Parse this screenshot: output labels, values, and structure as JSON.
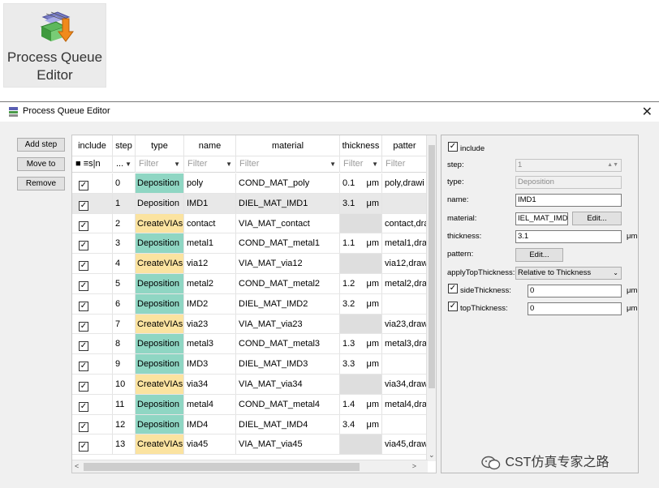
{
  "ribbon": {
    "label": "Process Queue\nEditor",
    "icon": "process-queue-icon"
  },
  "dialog": {
    "title": "Process Queue Editor",
    "close": "✕"
  },
  "left_buttons": [
    "Add step",
    "Move to",
    "Remove"
  ],
  "table": {
    "columns": [
      "include",
      "step",
      "type",
      "name",
      "material",
      "thickness",
      "patter"
    ],
    "filter_row": {
      "include": "■  ≡s|n",
      "step": "...",
      "type": "Filter",
      "name": "Filter",
      "material": "Filter",
      "thickness": "Filter",
      "pattern": "Filter"
    },
    "rows": [
      {
        "step": "0",
        "type": "Deposition",
        "name": "poly",
        "material": "COND_MAT_poly",
        "thickness": "0.1",
        "unit": "μm",
        "pattern": "poly,drawi"
      },
      {
        "step": "1",
        "type": "Deposition",
        "name": "IMD1",
        "material": "DIEL_MAT_IMD1",
        "thickness": "3.1",
        "unit": "μm",
        "pattern": ""
      },
      {
        "step": "2",
        "type": "CreateVIAs",
        "name": "contact",
        "material": "VIA_MAT_contact",
        "thickness": "",
        "unit": "",
        "pattern": "contact,dra"
      },
      {
        "step": "3",
        "type": "Deposition",
        "name": "metal1",
        "material": "COND_MAT_metal1",
        "thickness": "1.1",
        "unit": "μm",
        "pattern": "metal1,dra"
      },
      {
        "step": "4",
        "type": "CreateVIAs",
        "name": "via12",
        "material": "VIA_MAT_via12",
        "thickness": "",
        "unit": "",
        "pattern": "via12,draw"
      },
      {
        "step": "5",
        "type": "Deposition",
        "name": "metal2",
        "material": "COND_MAT_metal2",
        "thickness": "1.2",
        "unit": "μm",
        "pattern": "metal2,dra"
      },
      {
        "step": "6",
        "type": "Deposition",
        "name": "IMD2",
        "material": "DIEL_MAT_IMD2",
        "thickness": "3.2",
        "unit": "μm",
        "pattern": ""
      },
      {
        "step": "7",
        "type": "CreateVIAs",
        "name": "via23",
        "material": "VIA_MAT_via23",
        "thickness": "",
        "unit": "",
        "pattern": "via23,draw"
      },
      {
        "step": "8",
        "type": "Deposition",
        "name": "metal3",
        "material": "COND_MAT_metal3",
        "thickness": "1.3",
        "unit": "μm",
        "pattern": "metal3,dra"
      },
      {
        "step": "9",
        "type": "Deposition",
        "name": "IMD3",
        "material": "DIEL_MAT_IMD3",
        "thickness": "3.3",
        "unit": "μm",
        "pattern": ""
      },
      {
        "step": "10",
        "type": "CreateVIAs",
        "name": "via34",
        "material": "VIA_MAT_via34",
        "thickness": "",
        "unit": "",
        "pattern": "via34,draw"
      },
      {
        "step": "11",
        "type": "Deposition",
        "name": "metal4",
        "material": "COND_MAT_metal4",
        "thickness": "1.4",
        "unit": "μm",
        "pattern": "metal4,dra"
      },
      {
        "step": "12",
        "type": "Deposition",
        "name": "IMD4",
        "material": "DIEL_MAT_IMD4",
        "thickness": "3.4",
        "unit": "μm",
        "pattern": ""
      },
      {
        "step": "13",
        "type": "CreateVIAs",
        "name": "via45",
        "material": "VIA_MAT_via45",
        "thickness": "",
        "unit": "",
        "pattern": "via45,draw"
      }
    ],
    "selected_row": 1
  },
  "props": {
    "include_label": "include",
    "step_label": "step:",
    "step_value": "1",
    "type_label": "type:",
    "type_value": "Deposition",
    "name_label": "name:",
    "name_value": "IMD1",
    "material_label": "material:",
    "material_value": "IEL_MAT_IMD1",
    "material_edit": "Edit...",
    "thickness_label": "thickness:",
    "thickness_value": "3.1",
    "thickness_unit": "μm",
    "pattern_label": "pattern:",
    "pattern_edit": "Edit...",
    "applytop_label": "applyTopThickness:",
    "applytop_value": "Relative to Thickness",
    "side_label": "sideThickness:",
    "side_value": "0",
    "side_unit": "μm",
    "top_label": "topThickness:",
    "top_value": "0",
    "top_unit": "μm"
  },
  "colors": {
    "deposition": "#8fd6c3",
    "createvias": "#fbe3a0"
  },
  "watermark": "CST仿真专家之路"
}
